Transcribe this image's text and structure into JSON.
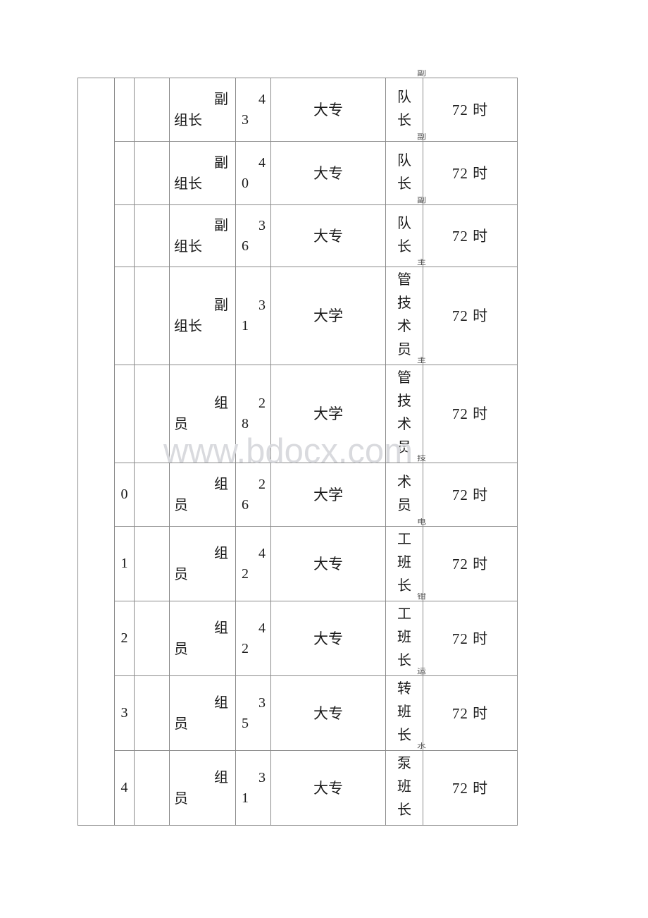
{
  "document": {
    "watermark": "www.bdocx.com",
    "page_background": "#ffffff",
    "border_color": "#8a8a8a",
    "watermark_color": "#d9dade"
  },
  "table": {
    "name": "personnel-roster-table",
    "columns": [
      {
        "key": "group_col",
        "label": ""
      },
      {
        "key": "index",
        "label": ""
      },
      {
        "key": "name_col",
        "label": ""
      },
      {
        "key": "role",
        "label": ""
      },
      {
        "key": "age",
        "label": ""
      },
      {
        "key": "education",
        "label": ""
      },
      {
        "key": "job_title",
        "label": ""
      },
      {
        "key": "hours",
        "label": ""
      }
    ],
    "rows": [
      {
        "group_col": "",
        "index": "",
        "name_col": "",
        "role_line1": "副",
        "role_line2": "组长",
        "age_line1": "4",
        "age_line2": "3",
        "age_full": "43",
        "education": "大专",
        "title_clip": "副",
        "title_chars": [
          "队",
          "长"
        ],
        "title_full": "副队长",
        "hours": "72 时"
      },
      {
        "group_col": "",
        "index": "",
        "name_col": "",
        "role_line1": "副",
        "role_line2": "组长",
        "age_line1": "4",
        "age_line2": "0",
        "age_full": "40",
        "education": "大专",
        "title_clip": "副",
        "title_chars": [
          "队",
          "长"
        ],
        "title_full": "副队长",
        "hours": "72 时"
      },
      {
        "group_col": "",
        "index": "",
        "name_col": "",
        "role_line1": "副",
        "role_line2": "组长",
        "age_line1": "3",
        "age_line2": "6",
        "age_full": "36",
        "education": "大专",
        "title_clip": "副",
        "title_chars": [
          "队",
          "长"
        ],
        "title_full": "副队长",
        "hours": "72 时"
      },
      {
        "group_col": "",
        "index": "",
        "name_col": "",
        "role_line1": "副",
        "role_line2": "组长",
        "age_line1": "3",
        "age_line2": "1",
        "age_full": "31",
        "education": "大学",
        "title_clip": "主",
        "title_chars": [
          "管",
          "技",
          "术",
          "员"
        ],
        "title_full": "主管技术员",
        "hours": "72 时"
      },
      {
        "group_col": "",
        "index": "",
        "name_col": "",
        "role_line1": "组",
        "role_line2": "员",
        "age_line1": "2",
        "age_line2": "8",
        "age_full": "28",
        "education": "大学",
        "title_clip": "主",
        "title_chars": [
          "管",
          "技",
          "术",
          "员"
        ],
        "title_full": "主管技术员",
        "hours": "72 时"
      },
      {
        "group_col": "",
        "index": "0",
        "name_col": "",
        "role_line1": "组",
        "role_line2": "员",
        "age_line1": "2",
        "age_line2": "6",
        "age_full": "26",
        "education": "大学",
        "title_clip": "技",
        "title_chars": [
          "术",
          "员"
        ],
        "title_full": "技术员",
        "hours": "72 时"
      },
      {
        "group_col": "",
        "index": "1",
        "name_col": "",
        "role_line1": "组",
        "role_line2": "员",
        "age_line1": "4",
        "age_line2": "2",
        "age_full": "42",
        "education": "大专",
        "title_clip": "电",
        "title_chars": [
          "工",
          "班",
          "长"
        ],
        "title_full": "电工班长",
        "hours": "72 时"
      },
      {
        "group_col": "",
        "index": "2",
        "name_col": "",
        "role_line1": "组",
        "role_line2": "员",
        "age_line1": "4",
        "age_line2": "2",
        "age_full": "42",
        "education": "大专",
        "title_clip": "钳",
        "title_chars": [
          "工",
          "班",
          "长"
        ],
        "title_full": "钳工班长",
        "hours": "72 时"
      },
      {
        "group_col": "",
        "index": "3",
        "name_col": "",
        "role_line1": "组",
        "role_line2": "员",
        "age_line1": "3",
        "age_line2": "5",
        "age_full": "35",
        "education": "大专",
        "title_clip": "运",
        "title_chars": [
          "转",
          "班",
          "长"
        ],
        "title_full": "运转班长",
        "hours": "72 时"
      },
      {
        "group_col": "",
        "index": "4",
        "name_col": "",
        "role_line1": "组",
        "role_line2": "员",
        "age_line1": "3",
        "age_line2": "1",
        "age_full": "31",
        "education": "大专",
        "title_clip": "水",
        "title_chars": [
          "泵",
          "班",
          "长"
        ],
        "title_full": "水泵班长",
        "hours": "72 时"
      }
    ]
  }
}
